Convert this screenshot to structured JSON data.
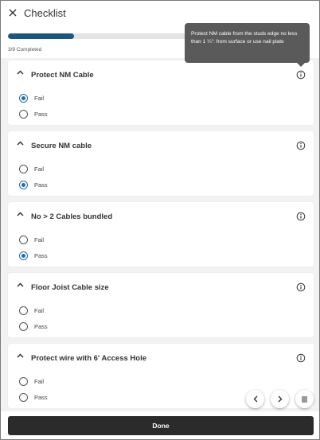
{
  "header": {
    "title": "Checklist"
  },
  "progress": {
    "completed": 3,
    "total": 9,
    "fraction": 0.333,
    "text": "3/9 Completed"
  },
  "tooltip": {
    "text": "Protect NM cable from the studs edge no less than 1 ¼\": from surface or use nail plate"
  },
  "items": [
    {
      "title": "Protect NM Cable",
      "options": [
        {
          "label": "Fail",
          "checked": true
        },
        {
          "label": "Pass",
          "checked": false
        }
      ]
    },
    {
      "title": "Secure NM cable",
      "options": [
        {
          "label": "Fail",
          "checked": false
        },
        {
          "label": "Pass",
          "checked": true
        }
      ]
    },
    {
      "title": "No > 2 Cables bundled",
      "options": [
        {
          "label": "Fail",
          "checked": false
        },
        {
          "label": "Pass",
          "checked": true
        }
      ]
    },
    {
      "title": "Floor Joist Cable size",
      "options": [
        {
          "label": "Fail",
          "checked": false
        },
        {
          "label": "Pass",
          "checked": false
        }
      ]
    },
    {
      "title": "Protect wire with 6' Access Hole",
      "options": [
        {
          "label": "Fail",
          "checked": false
        },
        {
          "label": "Pass",
          "checked": false
        }
      ]
    }
  ],
  "footer": {
    "done_label": "Done"
  },
  "icons": {
    "close": "close-icon",
    "chevron": "chevron-up-icon",
    "info": "info-icon",
    "prev": "chevron-left-icon",
    "next": "chevron-right-icon",
    "menu": "list-menu-icon"
  },
  "colors": {
    "accent": "#1f6cb3",
    "progress": "#1b5682",
    "done_button": "#2b2b2b",
    "tooltip": "#5a5a5a"
  }
}
